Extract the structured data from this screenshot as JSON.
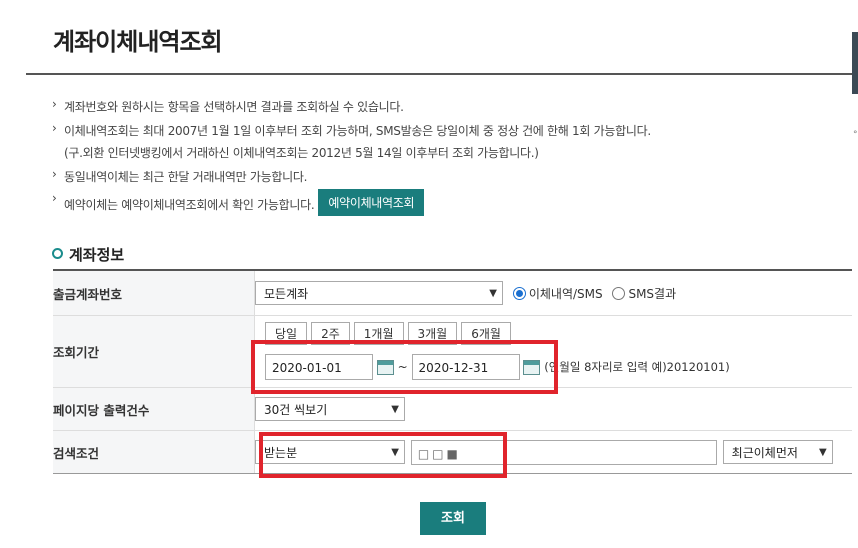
{
  "page": {
    "title": "계좌이체내역조회"
  },
  "notes": {
    "n1": "계좌번호와 원하시는 항목을 선택하시면 결과를 조회하실 수 있습니다.",
    "n2": "이체내역조회는 최대 2007년 1월 1일 이후부터 조회 가능하며, SMS발송은 당일이체 중 정상 건에 한해 1회 가능합니다.",
    "n2b": "(구.외환 인터넷뱅킹에서 거래하신 이체내역조회는 2012년 5월 14일 이후부터 조회 가능합니다.)",
    "n3": "동일내역이체는 최근 한달 거래내역만 가능합니다.",
    "n4": "예약이체는 예약이체내역조회에서 확인 가능합니다.",
    "reserve_button": "예약이체내역조회"
  },
  "section": {
    "title": "계좌정보"
  },
  "form": {
    "account": {
      "label": "출금계좌번호",
      "select_value": "모든계좌",
      "radio1": "이체내역/SMS",
      "radio2": "SMS결과",
      "radio_selected": "이체내역/SMS"
    },
    "period": {
      "label": "조회기간",
      "buttons": [
        "당일",
        "2주",
        "1개월",
        "3개월",
        "6개월"
      ],
      "from": "2020-01-01",
      "tilde": "~",
      "to": "2020-12-31",
      "hint": "(연월일 8자리로 입력 예)20120101)"
    },
    "per_page": {
      "label": "페이지당 출력건수",
      "select_value": "30건 씩보기"
    },
    "search": {
      "label": "검색조건",
      "type_value": "받는분",
      "keyword_value": "□□■",
      "order_value": "최근이체먼저"
    }
  },
  "submit_label": "조회",
  "colors": {
    "accent": "#1a7d7d",
    "highlight": "#e0242c"
  }
}
